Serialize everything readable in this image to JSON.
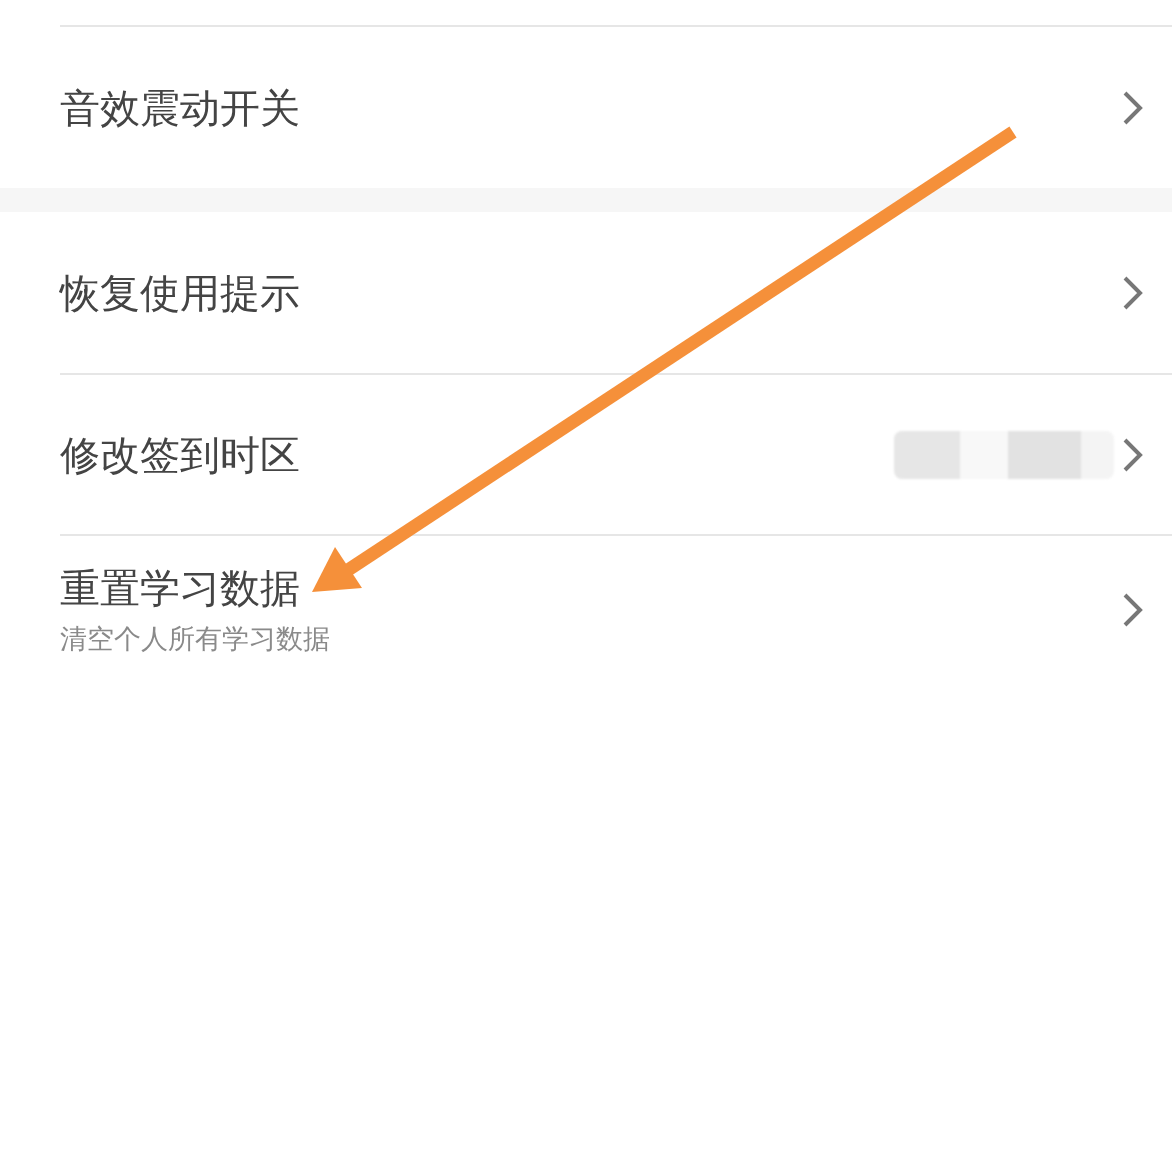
{
  "groups": [
    {
      "items": [
        {
          "title": "音效震动开关",
          "kind": "plain"
        }
      ]
    },
    {
      "items": [
        {
          "title": "恢复使用提示",
          "kind": "plain"
        },
        {
          "title": "修改签到时区",
          "kind": "blurred"
        },
        {
          "title": "重置学习数据",
          "subtitle": "清空个人所有学习数据",
          "kind": "plain"
        }
      ]
    }
  ],
  "annotation": {
    "kind": "arrow"
  }
}
